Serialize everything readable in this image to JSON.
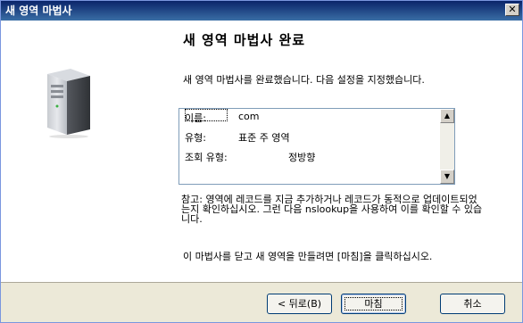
{
  "window": {
    "title": "새 영역 마법사"
  },
  "heading": "새 영역 마법사 완료",
  "intro": "새 영역 마법사를 완료했습니다. 다음 설정을 지정했습니다.",
  "summary": [
    {
      "label": "이름:",
      "value": "com"
    },
    {
      "label": "유형:",
      "value": "표준 주 영역"
    },
    {
      "label": "조회 유형:",
      "value": "정방향"
    }
  ],
  "note": "참고: 영역에 레코드를 지금 추가하거나 레코드가 동적으로 업데이트되었는지 확인하십시오. 그런 다음 nslookup을 사용하여 이를 확인할 수 있습니다.",
  "final": "이 마법사를 닫고 새 영역을 만들려면 [마침]을 클릭하십시오.",
  "buttons": {
    "back": "< 뒤로(B)",
    "finish": "마침",
    "cancel": "취소"
  },
  "icons": {
    "close": "close-icon",
    "server": "server-icon",
    "scroll_up": "scroll-up-icon",
    "scroll_down": "scroll-down-icon"
  }
}
